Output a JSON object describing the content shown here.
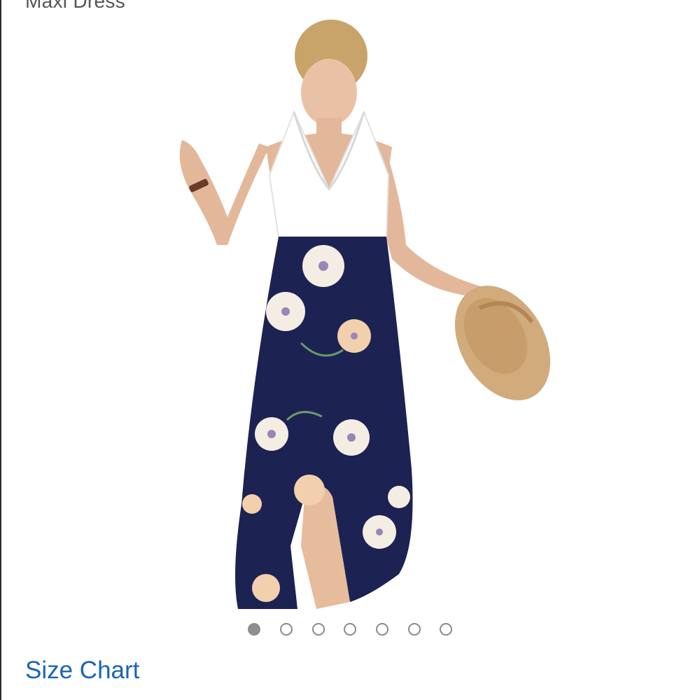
{
  "product": {
    "title_partial": "Maxi Dress",
    "image_alt": "Model wearing white lace halter top maxi dress with navy floral print skirt, holding a tan wide-brim hat"
  },
  "carousel": {
    "dot_count": 7,
    "active_index": 0
  },
  "links": {
    "size_chart": "Size Chart"
  },
  "colors": {
    "link": "#1b64b5",
    "dress_navy": "#1c2352",
    "hat_tan": "#d2ab7c"
  }
}
